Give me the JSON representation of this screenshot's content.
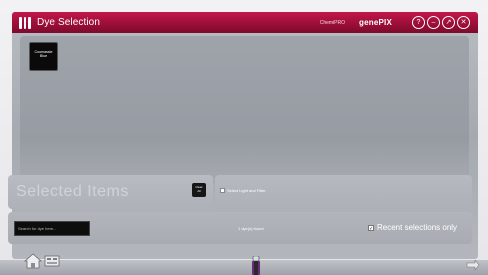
{
  "window": {
    "title": "Dye Selection",
    "product_small": "ChemiPRO",
    "brand": "genePIX",
    "controls": [
      {
        "name": "help",
        "glyph": "?"
      },
      {
        "name": "minimize",
        "glyph": "–"
      },
      {
        "name": "maximize",
        "glyph": "↗"
      },
      {
        "name": "close",
        "glyph": "✕"
      }
    ]
  },
  "dyes": [
    {
      "line1": "Coomassie",
      "line2": "Blue"
    }
  ],
  "selected": {
    "title": "Selected Items",
    "clear_line1": "Clear",
    "clear_line2": "All"
  },
  "light": {
    "label": "Select Light and Filter",
    "checked": false
  },
  "search": {
    "placeholder": "Search for dye here...",
    "found_text": "1 dye(s) found",
    "recent_label": "Recent selections only",
    "recent_checked": true
  },
  "colors": {
    "titlebar": "#9d0e38",
    "panel": "#a5a9b0"
  }
}
